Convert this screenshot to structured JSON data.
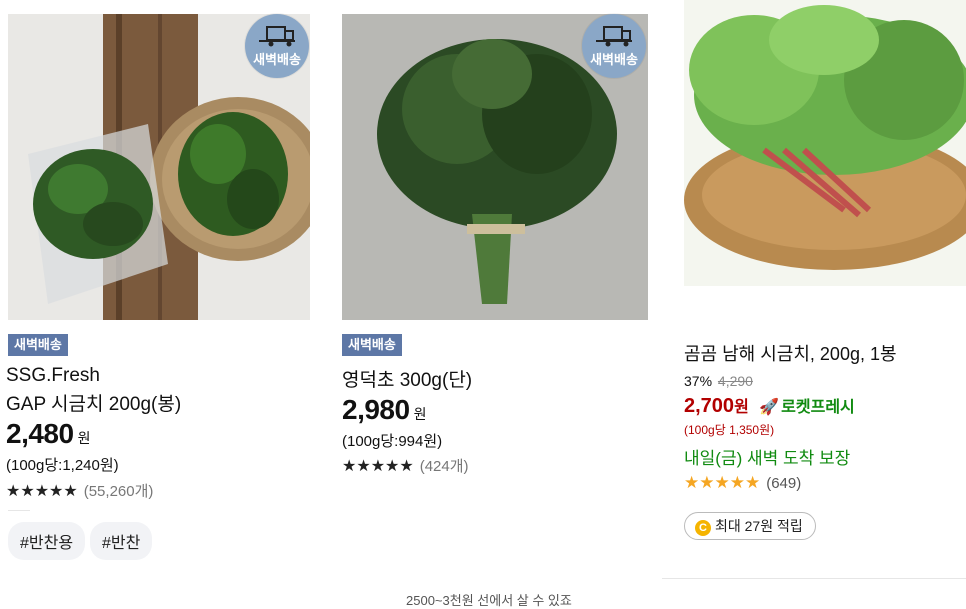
{
  "colors": {
    "dawn_badge": "#5d77a6",
    "delivery_circle": "#8aa7c7",
    "discount_red": "#b20000",
    "rocket_green": "#118b11",
    "star_orange": "#f5a623",
    "point_yellow": "#f5b400"
  },
  "products": [
    {
      "delivery_badge": "새벽배송",
      "dawn_tag": "새벽배송",
      "brand": "SSG.Fresh",
      "name": "GAP 시금치 200g(봉)",
      "price": "2,480",
      "currency": "원",
      "unit_price": "(100g당:1,240원)",
      "stars": "★★★★★",
      "reviews": "(55,260개)",
      "hashtags": [
        "#반찬용",
        "#반찬"
      ]
    },
    {
      "delivery_badge": "새벽배송",
      "dawn_tag": "새벽배송",
      "name": "영덕초 300g(단)",
      "price": "2,980",
      "currency": "원",
      "unit_price": "(100g당:994원)",
      "stars": "★★★★★",
      "reviews": "(424개)"
    },
    {
      "name": "곰곰 남해 시금치, 200g, 1봉",
      "discount": "37%",
      "original_price": "4,290",
      "price": "2,700",
      "currency": "원",
      "rocket_label": "로켓프레시",
      "unit_price": "(100g당 1,350원)",
      "delivery_info": "내일(금) 새벽 도착 보장",
      "stars": "★★★★★",
      "rating": 4.5,
      "reviews": "(649)",
      "points": "최대 27원 적립",
      "point_icon": "c-coin-icon"
    }
  ],
  "footer_note": "2500~3천원 선에서 살 수 있죠"
}
